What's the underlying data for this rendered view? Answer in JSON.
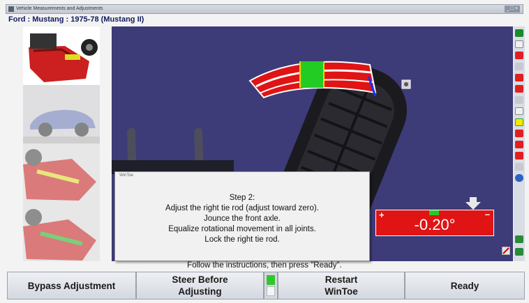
{
  "window": {
    "title": "Vehicle Measurements and Adjustments"
  },
  "vehicle": {
    "label": "Ford : Mustang : 1975-78 (Mustang II)"
  },
  "dialog": {
    "title": "WinToe",
    "step": "Step 2:",
    "lines": [
      "Adjust the right tie rod (adjust toward zero).",
      "Jounce the front axle.",
      "Equalize rotational movement in all joints.",
      "Lock the right tie rod."
    ]
  },
  "readout": {
    "value": "-0.20°",
    "plus": "+",
    "minus": "–"
  },
  "prompt": "Follow the instructions, then press \"Ready\".",
  "buttons": {
    "bypass": "Bypass Adjustment",
    "steer": "Steer Before Adjusting",
    "restart": "Restart WinToe",
    "ready": "Ready"
  },
  "colors": {
    "scene": "#3d3b78",
    "reading_red": "#e01414",
    "in_spec_green": "#22cc22"
  },
  "icons": [
    "camera-icon",
    "arrow-down-icon",
    "wrench-icon",
    "globe-icon",
    "car-icon"
  ]
}
